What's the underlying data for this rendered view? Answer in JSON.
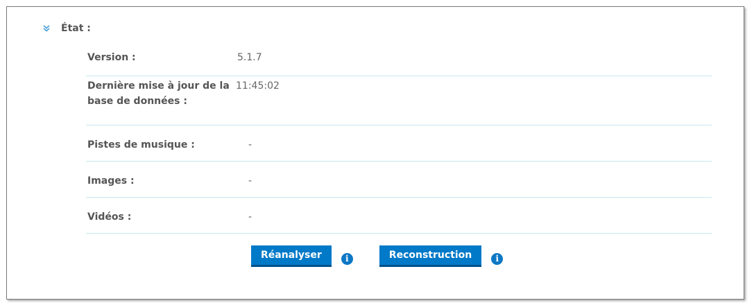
{
  "section": {
    "title": "État :",
    "icon": "chevron-down-icon"
  },
  "rows": [
    {
      "label": "Version :",
      "value": "5.1.7"
    },
    {
      "label": "Dernière mise à jour de la base de données :",
      "value": "11:45:02"
    },
    {
      "label": "Pistes de musique :",
      "value": "-"
    },
    {
      "label": "Images :",
      "value": "-"
    },
    {
      "label": "Vidéos :",
      "value": "-"
    }
  ],
  "actions": {
    "rescan_label": "Réanalyser",
    "rebuild_label": "Reconstruction",
    "info_icon": "info-icon",
    "info_glyph": "i"
  },
  "colors": {
    "button_bg": "#0079c8",
    "info_icon": "#0d78c5",
    "row_divider": "#c6e8ef",
    "chevron": "#4fa3dc"
  }
}
